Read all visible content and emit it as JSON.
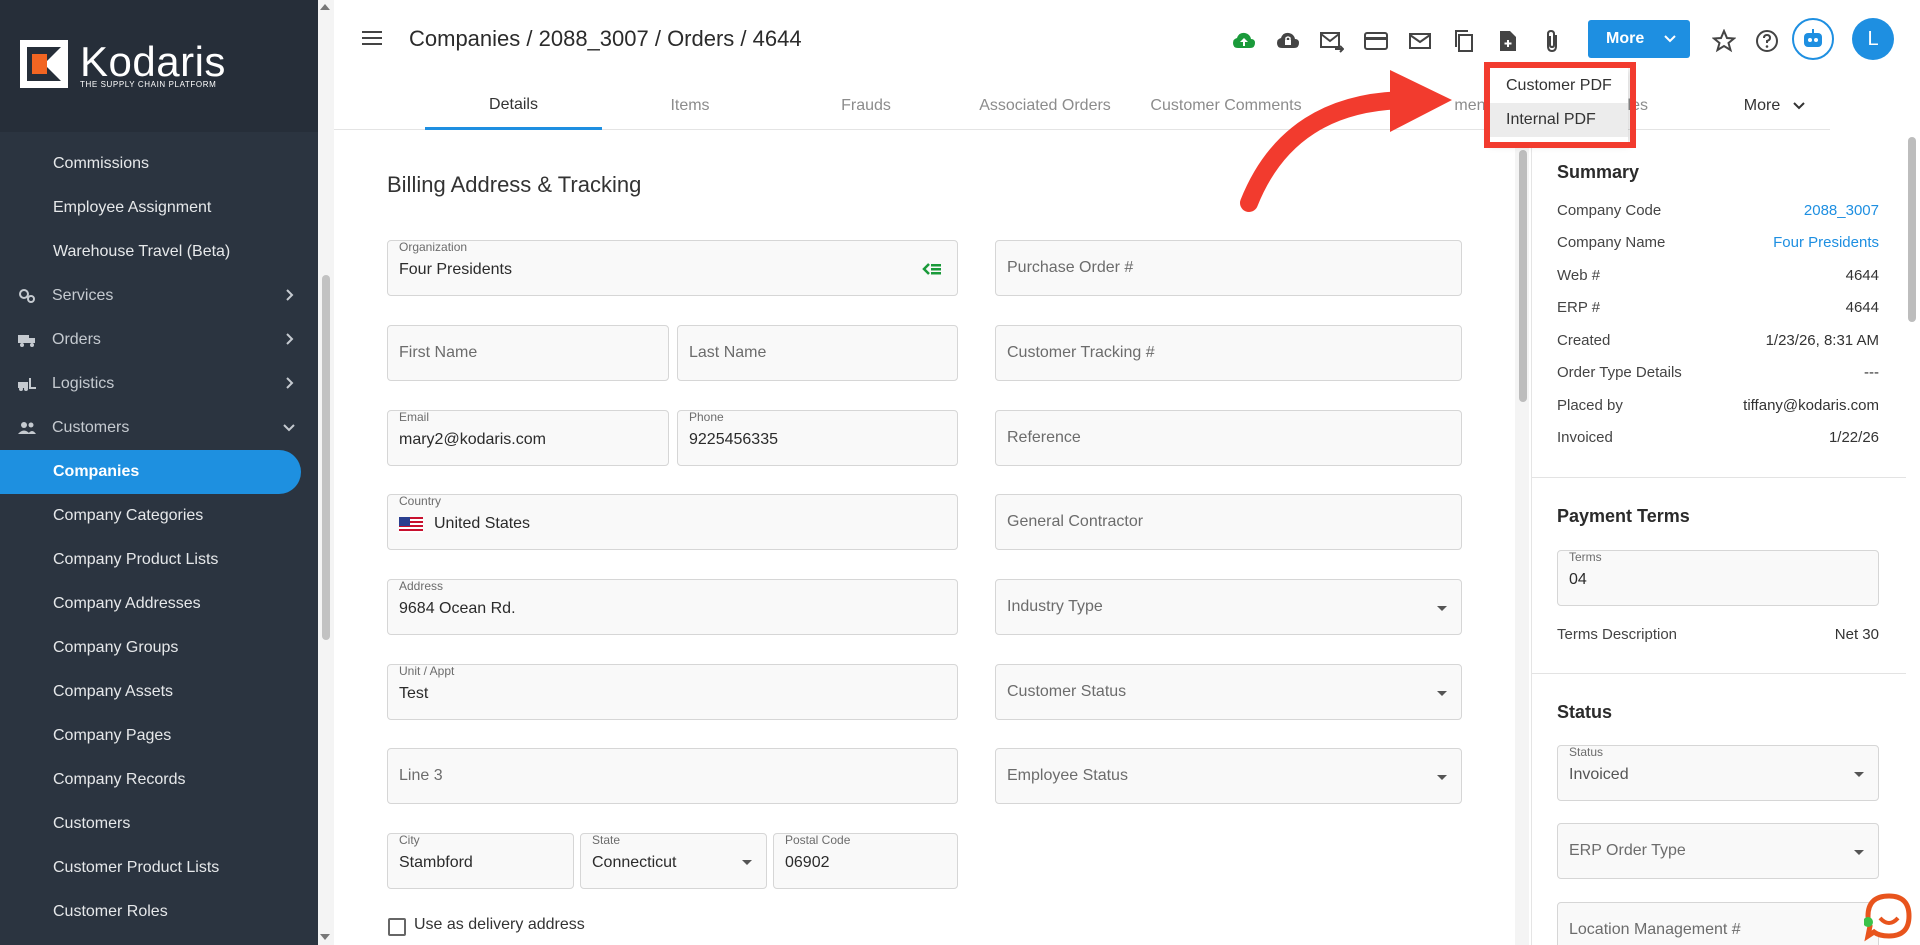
{
  "app": {
    "logo_name": "Kodaris",
    "logo_tagline": "THE SUPPLY CHAIN PLATFORM"
  },
  "sidebar": {
    "items": [
      {
        "label": "Commissions",
        "kind": "sub"
      },
      {
        "label": "Employee Assignment",
        "kind": "sub"
      },
      {
        "label": "Warehouse Travel (Beta)",
        "kind": "sub"
      },
      {
        "label": "Services",
        "kind": "parent",
        "icon": "services-icon"
      },
      {
        "label": "Orders",
        "kind": "parent",
        "icon": "truck-icon"
      },
      {
        "label": "Logistics",
        "kind": "parent",
        "icon": "forklift-icon"
      },
      {
        "label": "Customers",
        "kind": "parent-open",
        "icon": "people-icon"
      },
      {
        "label": "Companies",
        "kind": "sub-active"
      },
      {
        "label": "Company Categories",
        "kind": "sub"
      },
      {
        "label": "Company Product Lists",
        "kind": "sub"
      },
      {
        "label": "Company Addresses",
        "kind": "sub"
      },
      {
        "label": "Company Groups",
        "kind": "sub"
      },
      {
        "label": "Company Assets",
        "kind": "sub"
      },
      {
        "label": "Company Pages",
        "kind": "sub"
      },
      {
        "label": "Company Records",
        "kind": "sub"
      },
      {
        "label": "Customers",
        "kind": "sub"
      },
      {
        "label": "Customer Product Lists",
        "kind": "sub"
      },
      {
        "label": "Customer Roles",
        "kind": "sub"
      }
    ]
  },
  "header": {
    "breadcrumb": "Companies / 2088_3007 / Orders / 4644",
    "more_label": "More",
    "avatar_initial": "L",
    "toolbar_icons": [
      "cloud-upload-icon",
      "cloud-lock-icon",
      "mail-forward-icon",
      "credit-card-icon",
      "mail-icon",
      "copy-icon",
      "file-add-icon",
      "paperclip-icon"
    ]
  },
  "tabs": [
    {
      "label": "Details",
      "active": true
    },
    {
      "label": "Items"
    },
    {
      "label": "Frauds"
    },
    {
      "label": "Associated Orders"
    },
    {
      "label": "Customer Comments"
    },
    {
      "label": "ments"
    },
    {
      "label": "iles"
    },
    {
      "label": "More"
    }
  ],
  "dropdown": {
    "items": [
      {
        "label": "Customer PDF"
      },
      {
        "label": "Internal PDF"
      }
    ]
  },
  "form": {
    "title": "Billing Address & Tracking",
    "organization": {
      "label": "Organization",
      "value": "Four Presidents"
    },
    "first_name": {
      "placeholder": "First Name"
    },
    "last_name": {
      "placeholder": "Last Name"
    },
    "email": {
      "label": "Email",
      "value": "mary2@kodaris.com"
    },
    "phone": {
      "label": "Phone",
      "value": "9225456335"
    },
    "country": {
      "label": "Country",
      "value": "United States"
    },
    "address": {
      "label": "Address",
      "value": "9684 Ocean Rd."
    },
    "unit": {
      "label": "Unit / Appt",
      "value": "Test"
    },
    "line3": {
      "placeholder": "Line 3"
    },
    "city": {
      "label": "City",
      "value": "Stambford"
    },
    "state": {
      "label": "State",
      "value": "Connecticut"
    },
    "postal": {
      "label": "Postal Code",
      "value": "06902"
    },
    "purchase_order": {
      "placeholder": "Purchase Order #"
    },
    "customer_tracking": {
      "placeholder": "Customer Tracking #"
    },
    "reference": {
      "placeholder": "Reference"
    },
    "general_contractor": {
      "placeholder": "General Contractor"
    },
    "industry_type": {
      "placeholder": "Industry Type"
    },
    "customer_status": {
      "placeholder": "Customer Status"
    },
    "employee_status": {
      "placeholder": "Employee Status"
    },
    "use_as_delivery": "Use as delivery address"
  },
  "summary": {
    "title": "Summary",
    "rows": [
      {
        "key": "Company Code",
        "value": "2088_3007",
        "link": true
      },
      {
        "key": "Company Name",
        "value": "Four Presidents",
        "link": true
      },
      {
        "key": "Web #",
        "value": "4644"
      },
      {
        "key": "ERP #",
        "value": "4644"
      },
      {
        "key": "Created",
        "value": "1/23/26, 8:31 AM"
      },
      {
        "key": "Order Type Details",
        "value": "---"
      },
      {
        "key": "Placed by",
        "value": "tiffany@kodaris.com"
      },
      {
        "key": "Invoiced",
        "value": "1/22/26"
      }
    ]
  },
  "payment_terms": {
    "title": "Payment Terms",
    "terms_label": "Terms",
    "terms_value": "04",
    "desc_key": "Terms Description",
    "desc_value": "Net 30"
  },
  "status": {
    "title": "Status",
    "status_label": "Status",
    "status_value": "Invoiced",
    "erp_order_type": "ERP Order Type",
    "location_mgmt": "Location Management #"
  },
  "colors": {
    "accent": "#1e8fe1",
    "sidebar": "#2b3440",
    "highlight": "#f23b2e"
  }
}
